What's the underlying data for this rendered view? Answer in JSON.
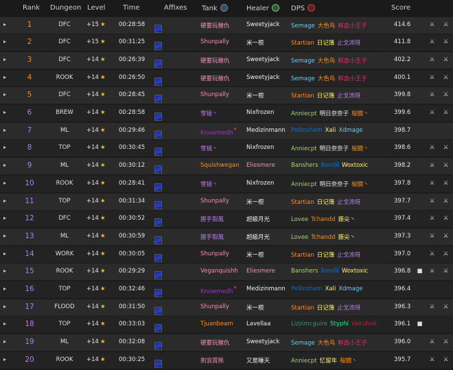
{
  "header": {
    "rank": "Rank",
    "dungeon": "Dungeon",
    "level": "Level",
    "time": "Time",
    "affixes": "Affixes",
    "tank": "Tank",
    "healer": "Healer",
    "dps": "DPS",
    "score": "Score"
  },
  "rows": [
    {
      "rank": "1",
      "dungeon": "DFC",
      "level": "+15",
      "time": "00:28:58",
      "tank": {
        "name": "硬要玩豬仇",
        "color": "#f58cba"
      },
      "healer": {
        "name": "Sweetyjack",
        "color": "#f0f0f0"
      },
      "dps": [
        {
          "name": "Semage",
          "color": "#69ccf0"
        },
        {
          "name": "大色鸟",
          "color": "#ff8c1a"
        },
        {
          "name": "鲜血小王子",
          "color": "#e0306a"
        }
      ],
      "score": "414.6",
      "icons": [
        "sword",
        "sword"
      ]
    },
    {
      "rank": "2",
      "dungeon": "DFC",
      "level": "+15",
      "time": "00:31:25",
      "tank": {
        "name": "Shunpally",
        "color": "#f58cba"
      },
      "healer": {
        "name": "米一根",
        "color": "#f0f0f0"
      },
      "dps": [
        {
          "name": "Startian",
          "color": "#ff8c1a"
        },
        {
          "name": "日记簿",
          "color": "#fff468"
        },
        {
          "name": "止戈流呀",
          "color": "#b77cf0"
        }
      ],
      "score": "411.8",
      "icons": [
        "sword",
        "sword"
      ]
    },
    {
      "rank": "3",
      "dungeon": "DFC",
      "level": "+14",
      "time": "00:26:39",
      "tank": {
        "name": "硬要玩豬仇",
        "color": "#f58cba"
      },
      "healer": {
        "name": "Sweetyjack",
        "color": "#f0f0f0"
      },
      "dps": [
        {
          "name": "Semage",
          "color": "#69ccf0"
        },
        {
          "name": "大色鸟",
          "color": "#ff8c1a"
        },
        {
          "name": "鲜血小王子",
          "color": "#e0306a"
        }
      ],
      "score": "402.2",
      "icons": [
        "sword",
        "sword"
      ]
    },
    {
      "rank": "4",
      "dungeon": "ROOK",
      "level": "+14",
      "time": "00:26:50",
      "tank": {
        "name": "硬要玩豬仇",
        "color": "#f58cba"
      },
      "healer": {
        "name": "Sweetyjack",
        "color": "#f0f0f0"
      },
      "dps": [
        {
          "name": "Semage",
          "color": "#69ccf0"
        },
        {
          "name": "大色鸟",
          "color": "#ff8c1a"
        },
        {
          "name": "鲜血小王子",
          "color": "#e0306a"
        }
      ],
      "score": "400.1",
      "icons": [
        "sword",
        "sword"
      ]
    },
    {
      "rank": "5",
      "dungeon": "DFC",
      "level": "+14",
      "time": "00:28:45",
      "tank": {
        "name": "Shunpally",
        "color": "#f58cba"
      },
      "healer": {
        "name": "米一根",
        "color": "#f0f0f0"
      },
      "dps": [
        {
          "name": "Startian",
          "color": "#ff8c1a"
        },
        {
          "name": "日记簿",
          "color": "#fff468"
        },
        {
          "name": "止戈流呀",
          "color": "#b77cf0"
        }
      ],
      "score": "399.8",
      "icons": [
        "sword",
        "sword"
      ]
    },
    {
      "rank": "6",
      "dungeon": "BREW",
      "level": "+14",
      "time": "00:28:58",
      "tank": {
        "name": "雪镜丶",
        "color": "#b77cf0"
      },
      "healer": {
        "name": "Nixfrozen",
        "color": "#f0f0f0"
      },
      "dps": [
        {
          "name": "Anniecpt",
          "color": "#aad372"
        },
        {
          "name": "明日奈奈子",
          "color": "#f0f0f0"
        },
        {
          "name": "桜闘丶",
          "color": "#ff8c1a"
        }
      ],
      "score": "399.6",
      "icons": [
        "sword",
        "sword"
      ]
    },
    {
      "rank": "7",
      "dungeon": "ML",
      "level": "+14",
      "time": "00:29:46",
      "tank": {
        "name": "Knowmedh",
        "color": "#a330c9",
        "tag": "*"
      },
      "healer": {
        "name": "Medizinmann",
        "color": "#f0f0f0"
      },
      "dps": [
        {
          "name": "Pelkosham",
          "color": "#0070dd"
        },
        {
          "name": "Xali",
          "color": "#fff468"
        },
        {
          "name": "Xdmage",
          "color": "#69ccf0"
        }
      ],
      "score": "398.7",
      "icons": []
    },
    {
      "rank": "8",
      "dungeon": "TOP",
      "level": "+14",
      "time": "00:30:45",
      "tank": {
        "name": "雪镜丶",
        "color": "#b77cf0"
      },
      "healer": {
        "name": "Nixfrozen",
        "color": "#f0f0f0"
      },
      "dps": [
        {
          "name": "Anniecpt",
          "color": "#aad372"
        },
        {
          "name": "明日奈奈子",
          "color": "#f0f0f0"
        },
        {
          "name": "桜闘丶",
          "color": "#ff8c1a"
        }
      ],
      "score": "398.6",
      "icons": [
        "sword",
        "sword"
      ]
    },
    {
      "rank": "9",
      "dungeon": "ML",
      "level": "+14",
      "time": "00:30:12",
      "tank": {
        "name": "Squishwegan",
        "color": "#ff8c1a"
      },
      "healer": {
        "name": "Eliesmere",
        "color": "#f58cba"
      },
      "dps": [
        {
          "name": "Banshers",
          "color": "#aad372"
        },
        {
          "name": "Bondil",
          "color": "#0070dd"
        },
        {
          "name": "Woxtoxic",
          "color": "#fff468"
        }
      ],
      "score": "398.2",
      "icons": [
        "sword",
        "sword"
      ]
    },
    {
      "rank": "10",
      "dungeon": "ROOK",
      "level": "+14",
      "time": "00:28:41",
      "tank": {
        "name": "雪镜丶",
        "color": "#b77cf0"
      },
      "healer": {
        "name": "Nixfrozen",
        "color": "#f0f0f0"
      },
      "dps": [
        {
          "name": "Anniecpt",
          "color": "#aad372"
        },
        {
          "name": "明日奈奈子",
          "color": "#f0f0f0"
        },
        {
          "name": "桜闘丶",
          "color": "#ff8c1a"
        }
      ],
      "score": "397.8",
      "icons": [
        "sword",
        "sword"
      ]
    },
    {
      "rank": "11",
      "dungeon": "TOP",
      "level": "+14",
      "time": "00:31:34",
      "tank": {
        "name": "Shunpally",
        "color": "#f58cba"
      },
      "healer": {
        "name": "米一根",
        "color": "#f0f0f0"
      },
      "dps": [
        {
          "name": "Startian",
          "color": "#ff8c1a"
        },
        {
          "name": "日记簿",
          "color": "#fff468"
        },
        {
          "name": "止戈流呀",
          "color": "#b77cf0"
        }
      ],
      "score": "397.7",
      "icons": [
        "sword",
        "sword"
      ]
    },
    {
      "rank": "12",
      "dungeon": "DFC",
      "level": "+14",
      "time": "00:30:52",
      "tank": {
        "name": "握手裂風",
        "color": "#b77cf0"
      },
      "healer": {
        "name": "超級月光",
        "color": "#f0f0f0"
      },
      "dps": [
        {
          "name": "Lovee",
          "color": "#aad372"
        },
        {
          "name": "Tchandd",
          "color": "#ff8c1a"
        },
        {
          "name": "振尖丶",
          "color": "#fff468"
        }
      ],
      "score": "397.4",
      "icons": [
        "sword",
        "sword"
      ]
    },
    {
      "rank": "13",
      "dungeon": "ML",
      "level": "+14",
      "time": "00:30:59",
      "tank": {
        "name": "握手裂風",
        "color": "#b77cf0"
      },
      "healer": {
        "name": "超級月光",
        "color": "#f0f0f0"
      },
      "dps": [
        {
          "name": "Lovee",
          "color": "#aad372"
        },
        {
          "name": "Tchandd",
          "color": "#ff8c1a"
        },
        {
          "name": "振尖丶",
          "color": "#fff468"
        }
      ],
      "score": "397.3",
      "icons": [
        "sword",
        "sword"
      ]
    },
    {
      "rank": "14",
      "dungeon": "WORK",
      "level": "+14",
      "time": "00:30:05",
      "tank": {
        "name": "Shunpally",
        "color": "#f58cba"
      },
      "healer": {
        "name": "米一根",
        "color": "#f0f0f0"
      },
      "dps": [
        {
          "name": "Startian",
          "color": "#ff8c1a"
        },
        {
          "name": "日记簿",
          "color": "#fff468"
        },
        {
          "name": "止戈流呀",
          "color": "#b77cf0"
        }
      ],
      "score": "397.0",
      "icons": [
        "sword",
        "sword"
      ]
    },
    {
      "rank": "15",
      "dungeon": "ROOK",
      "level": "+14",
      "time": "00:29:29",
      "tank": {
        "name": "Veganquishh",
        "color": "#f58cba"
      },
      "healer": {
        "name": "Eliesmere",
        "color": "#f58cba"
      },
      "dps": [
        {
          "name": "Banshers",
          "color": "#aad372"
        },
        {
          "name": "Bondil",
          "color": "#0070dd"
        },
        {
          "name": "Woxtoxic",
          "color": "#fff468"
        }
      ],
      "score": "396.8",
      "icons": [
        "camera",
        "sword",
        "sword"
      ]
    },
    {
      "rank": "16",
      "dungeon": "TOP",
      "level": "+14",
      "time": "00:32:46",
      "tank": {
        "name": "Knowmedh",
        "color": "#a330c9",
        "tag": "*"
      },
      "healer": {
        "name": "Medizinmann",
        "color": "#f0f0f0"
      },
      "dps": [
        {
          "name": "Pelkosham",
          "color": "#0070dd"
        },
        {
          "name": "Xali",
          "color": "#fff468"
        },
        {
          "name": "Xdmage",
          "color": "#69ccf0"
        }
      ],
      "score": "396.4",
      "icons": []
    },
    {
      "rank": "17",
      "dungeon": "FLOOD",
      "level": "+14",
      "time": "00:31:50",
      "tank": {
        "name": "Shunpally",
        "color": "#f58cba"
      },
      "healer": {
        "name": "米一根",
        "color": "#f0f0f0"
      },
      "dps": [
        {
          "name": "Startian",
          "color": "#ff8c1a"
        },
        {
          "name": "日记簿",
          "color": "#fff468"
        },
        {
          "name": "止戈流呀",
          "color": "#b77cf0"
        }
      ],
      "score": "396.3",
      "icons": [
        "sword",
        "sword"
      ]
    },
    {
      "rank": "18",
      "dungeon": "TOP",
      "level": "+14",
      "time": "00:33:03",
      "tank": {
        "name": "Tjuanbeam",
        "color": "#ff8c1a"
      },
      "healer": {
        "name": "Lavellaa",
        "color": "#f0f0f0"
      },
      "dps": [
        {
          "name": "Lizzimcguire",
          "color": "#33937f"
        },
        {
          "name": "Styphi",
          "color": "#00ff98"
        },
        {
          "name": "Valruhok",
          "color": "#c41e3a"
        }
      ],
      "score": "396.1",
      "icons": [
        "camera"
      ]
    },
    {
      "rank": "19",
      "dungeon": "ML",
      "level": "+14",
      "time": "00:32:08",
      "tank": {
        "name": "硬要玩豬仇",
        "color": "#f58cba"
      },
      "healer": {
        "name": "Sweetyjack",
        "color": "#f0f0f0"
      },
      "dps": [
        {
          "name": "Semage",
          "color": "#69ccf0"
        },
        {
          "name": "大色鸟",
          "color": "#ff8c1a"
        },
        {
          "name": "鲜血小王子",
          "color": "#e0306a"
        }
      ],
      "score": "396.0",
      "icons": [
        "sword",
        "sword"
      ]
    },
    {
      "rank": "20",
      "dungeon": "ROOK",
      "level": "+14",
      "time": "00:30:25",
      "tank": {
        "name": "劍浪賞熊",
        "color": "#f58cba"
      },
      "healer": {
        "name": "又是睡天",
        "color": "#f0f0f0"
      },
      "dps": [
        {
          "name": "Anniecpt",
          "color": "#aad372"
        },
        {
          "name": "忆留年",
          "color": "#fff468"
        },
        {
          "name": "桜闘丶",
          "color": "#ff8c1a"
        }
      ],
      "score": "395.7",
      "icons": [
        "sword",
        "sword"
      ]
    }
  ],
  "rank_colors": {
    "top5": "#ff8c1a",
    "rest": "#b77cf0"
  },
  "icon_glyphs": {
    "sword": "⚔",
    "camera": "■"
  }
}
